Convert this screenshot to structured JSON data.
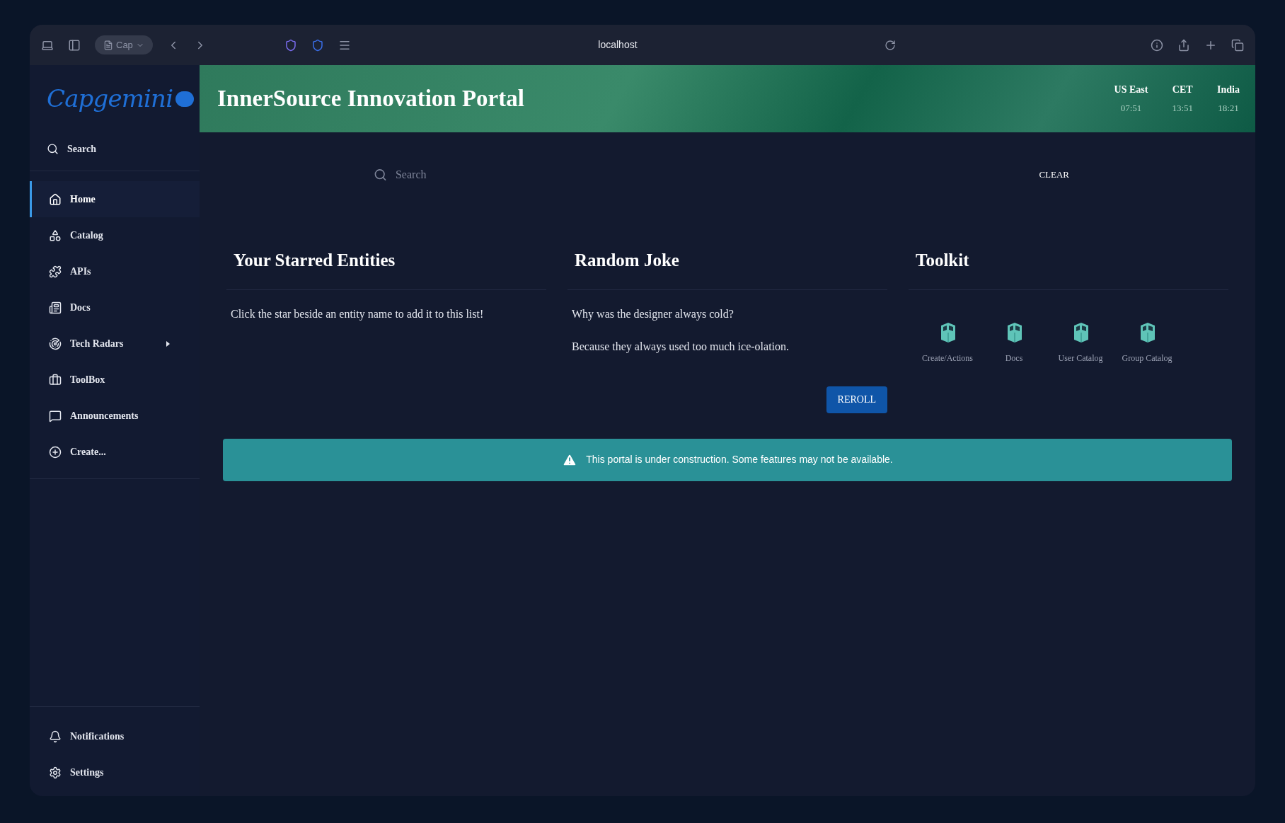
{
  "browser": {
    "tab_label": "Cap",
    "address": "localhost"
  },
  "sidebar": {
    "logo": "Capgemini",
    "search_label": "Search",
    "items": [
      {
        "label": "Home",
        "selected": true,
        "submenu": false
      },
      {
        "label": "Catalog",
        "selected": false,
        "submenu": false
      },
      {
        "label": "APIs",
        "selected": false,
        "submenu": false
      },
      {
        "label": "Docs",
        "selected": false,
        "submenu": false
      },
      {
        "label": "Tech Radars",
        "selected": false,
        "submenu": true
      },
      {
        "label": "ToolBox",
        "selected": false,
        "submenu": false
      },
      {
        "label": "Announcements",
        "selected": false,
        "submenu": false
      },
      {
        "label": "Create...",
        "selected": false,
        "submenu": false
      }
    ],
    "bottom_items": [
      {
        "label": "Notifications"
      },
      {
        "label": "Settings"
      }
    ]
  },
  "header": {
    "title": "InnerSource Innovation Portal",
    "clocks": [
      {
        "zone": "US East",
        "time": "07:51"
      },
      {
        "zone": "CET",
        "time": "13:51"
      },
      {
        "zone": "India",
        "time": "18:21"
      }
    ]
  },
  "search": {
    "placeholder": "Search",
    "clear_label": "CLEAR"
  },
  "starred": {
    "title": "Your Starred Entities",
    "text": "Click the star beside an entity name to add it to this list!"
  },
  "joke": {
    "title": "Random Joke",
    "setup": "Why was the designer always cold?",
    "punchline": "Because they always used too much ice-olation.",
    "button": "REROLL"
  },
  "toolkit": {
    "title": "Toolkit",
    "items": [
      {
        "label": "Create/Actions"
      },
      {
        "label": "Docs"
      },
      {
        "label": "User Catalog"
      },
      {
        "label": "Group Catalog"
      }
    ]
  },
  "banner": {
    "text": "This portal is under construction. Some features may not be available."
  }
}
